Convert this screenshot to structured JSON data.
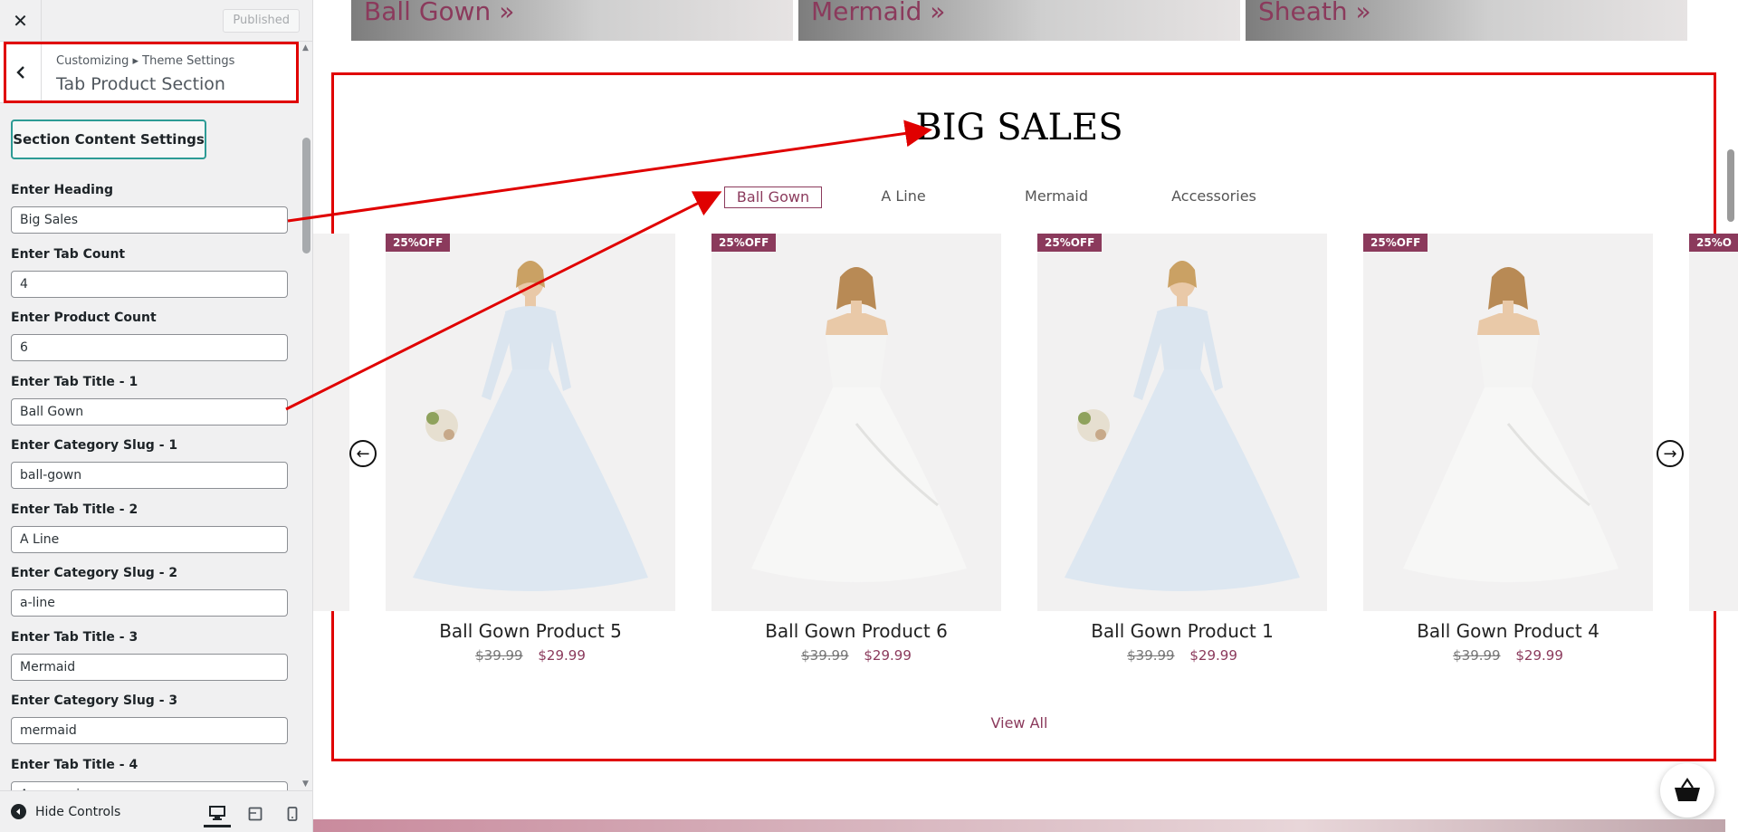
{
  "colors": {
    "annotation": "#e00000",
    "accent": "#8b3a5c",
    "teal": "#2d9b95"
  },
  "header": {
    "close_icon": "close-icon",
    "published_label": "Published"
  },
  "section_head": {
    "breadcrumb": "Customizing ▸ Theme Settings",
    "title": "Tab Product Section"
  },
  "controls": {
    "section_button": "Section Content Settings",
    "fields": [
      {
        "label": "Enter Heading",
        "value": "Big Sales"
      },
      {
        "label": "Enter Tab Count",
        "value": "4"
      },
      {
        "label": "Enter Product Count",
        "value": "6"
      },
      {
        "label": "Enter Tab Title - 1",
        "value": "Ball Gown"
      },
      {
        "label": "Enter Category Slug - 1",
        "value": "ball-gown"
      },
      {
        "label": "Enter Tab Title - 2",
        "value": "A Line"
      },
      {
        "label": "Enter Category Slug - 2",
        "value": "a-line"
      },
      {
        "label": "Enter Tab Title - 3",
        "value": "Mermaid"
      },
      {
        "label": "Enter Category Slug - 3",
        "value": "mermaid"
      },
      {
        "label": "Enter Tab Title - 4",
        "value": "Accessories"
      }
    ]
  },
  "footer": {
    "hide_controls": "Hide Controls"
  },
  "preview": {
    "banners": [
      "Ball Gown »",
      "Mermaid »",
      "Sheath »"
    ],
    "heading": "BIG SALES",
    "tabs": [
      "Ball Gown",
      "A Line",
      "Mermaid",
      "Accessories"
    ],
    "products": [
      {
        "badge": "25%OFF",
        "title": "Ball Gown Product 5",
        "old_price": "$39.99",
        "new_price": "$29.99"
      },
      {
        "badge": "25%OFF",
        "title": "Ball Gown Product 6",
        "old_price": "$39.99",
        "new_price": "$29.99"
      },
      {
        "badge": "25%OFF",
        "title": "Ball Gown Product 1",
        "old_price": "$39.99",
        "new_price": "$29.99"
      },
      {
        "badge": "25%OFF",
        "title": "Ball Gown Product 4",
        "old_price": "$39.99",
        "new_price": "$29.99"
      }
    ],
    "partial_badge": "25%O",
    "view_all": "View All"
  }
}
